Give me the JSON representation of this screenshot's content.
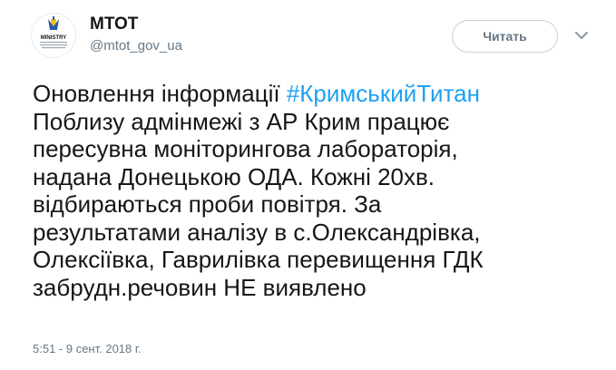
{
  "account": {
    "name": "МТОТ",
    "handle": "@mtot_gov_ua",
    "avatar_caption": "MINISTRY"
  },
  "follow_button": {
    "label": "Читать"
  },
  "tweet": {
    "line1_text": "Оновлення інформації ",
    "hashtag": "#КримськийТитан",
    "lines": [
      "Поблизу адмінмежі з АР Крим працює",
      "пересувна моніторингова лабораторія,",
      "надана Донецькою ОДА. Кожні 20хв.",
      "відбираються проби повітря. За",
      "результатами аналізу в с.Олександрівка,",
      "Олексіївка, Гаврилівка перевищення ГДК",
      "забрудн.речовин НЕ виявлено"
    ],
    "timestamp": "5:51 - 9 сент. 2018 г."
  },
  "colors": {
    "text": "#14171a",
    "secondary": "#657786",
    "link": "#1da1f2",
    "border": "#c7d0d6",
    "logo_blue": "#2b5aa8",
    "logo_yellow": "#f5c518"
  },
  "icons": {
    "avatar": "ministry-logo-icon",
    "menu": "chevron-down-icon"
  }
}
